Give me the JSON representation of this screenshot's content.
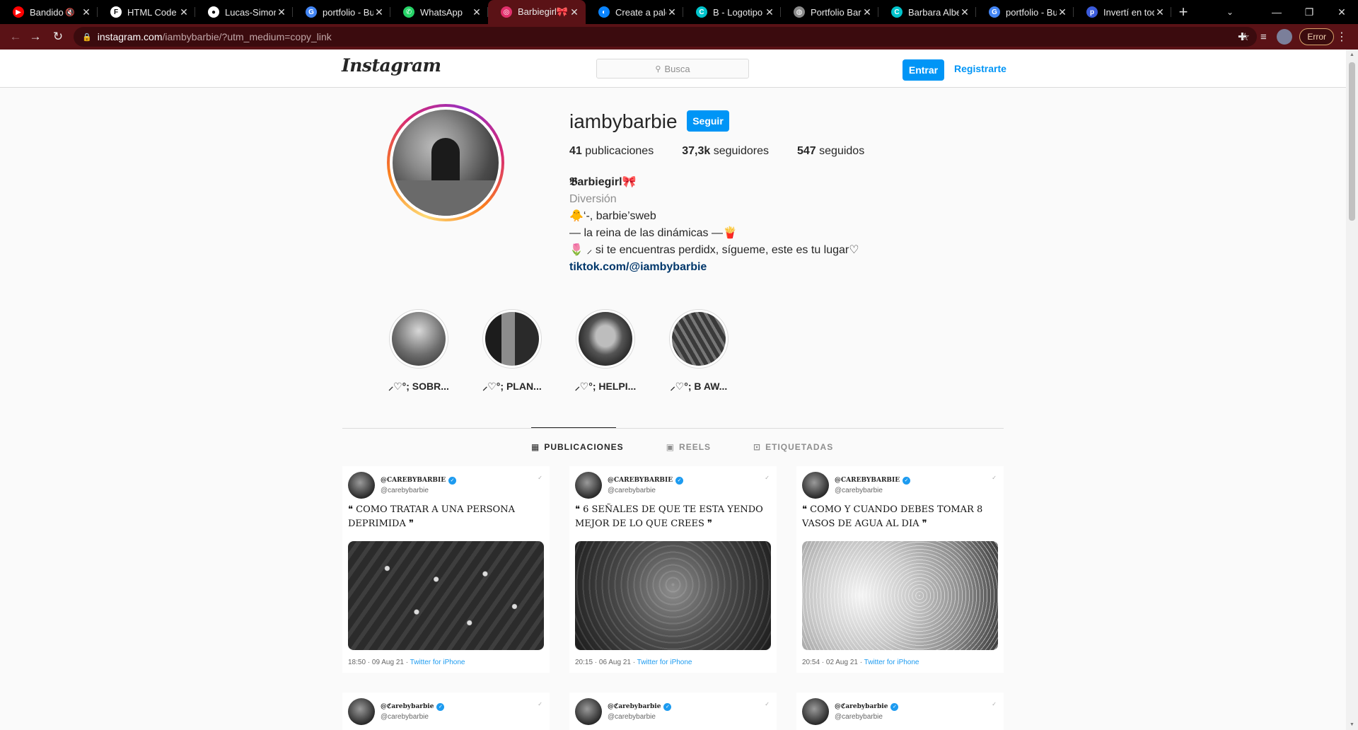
{
  "browser": {
    "tabs": [
      {
        "title": "Bandido",
        "favicon": "youtube-icon",
        "color": "#ff0000",
        "muted": true
      },
      {
        "title": "HTML Code E",
        "favicon": "html-code-icon",
        "color": "#ffffff"
      },
      {
        "title": "Lucas-Simon",
        "favicon": "github-icon",
        "color": "#ffffff"
      },
      {
        "title": "portfolio - Bu",
        "favicon": "google-icon",
        "color": "#4285f4"
      },
      {
        "title": "WhatsApp",
        "favicon": "whatsapp-icon",
        "color": "#25d366"
      },
      {
        "title": "Barbiegirl🎀 (@",
        "favicon": "instagram-icon",
        "color": "#e1306c",
        "active": true
      },
      {
        "title": "Create a pale",
        "favicon": "coolors-icon",
        "color": "#0a84ff"
      },
      {
        "title": "B - Logotipo",
        "favicon": "canva-icon",
        "color": "#00c4cc"
      },
      {
        "title": "Portfolio Barb",
        "favicon": "globe-icon",
        "color": "#8a8a8a"
      },
      {
        "title": "Barbara Alber",
        "favicon": "canva-icon",
        "color": "#00c4cc"
      },
      {
        "title": "portfolio - Bu",
        "favicon": "google-icon",
        "color": "#4285f4"
      },
      {
        "title": "Invertí en tod",
        "favicon": "ppi-icon",
        "color": "#3b5bdb"
      }
    ],
    "url_host": "instagram.com",
    "url_path": "/iambybarbie/?utm_medium=copy_link",
    "error_label": "Error",
    "accent": "#5a1216"
  },
  "ig": {
    "logo": "Instagram",
    "search_placeholder": "Busca",
    "login_label": "Entrar",
    "signup_label": "Registrarte",
    "username": "iambybarbie",
    "follow_label": "Seguir",
    "stats": {
      "posts_count": "41",
      "posts_label": "publicaciones",
      "followers_count": "37,3k",
      "followers_label": "seguidores",
      "following_count": "547",
      "following_label": "seguidos"
    },
    "bio": {
      "name": "𝕭arbiegirl🎀",
      "category": "Diversión",
      "line1": "🐥‘-, barbie’sweb",
      "line2": "— la reina de las dinámicas —🍟",
      "line3": "🌷 ⸝ si te encuentras perdidx, sígueme, este es tu lugar♡",
      "link": "tiktok.com/@iambybarbie"
    },
    "highlights": [
      {
        "label": "⸝♡°; SOBR..."
      },
      {
        "label": "⸝♡°; PLAN..."
      },
      {
        "label": "⸝♡°; HELPI..."
      },
      {
        "label": "⸝♡°; B AW..."
      }
    ],
    "tabs": [
      {
        "label": "PUBLICACIONES",
        "icon": "grid-icon",
        "active": true
      },
      {
        "label": "REELS",
        "icon": "reels-icon"
      },
      {
        "label": "ETIQUETADAS",
        "icon": "tagged-icon"
      }
    ],
    "posts": [
      {
        "handle": "@CAREBYBARBIE",
        "sub": "@carebybarbie",
        "quote": "❝ COMO TRATAR A UNA PERSONA DEPRIMIDA ❞",
        "time": "18:50 · 09 Aug 21 · ",
        "source": "Twitter for iPhone"
      },
      {
        "handle": "@CAREBYBARBIE",
        "sub": "@carebybarbie",
        "quote": "❝ 6 SEÑALES DE QUE TE ESTA YENDO MEJOR DE LO QUE CREES ❞",
        "time": "20:15 · 06 Aug 21 · ",
        "source": "Twitter for iPhone"
      },
      {
        "handle": "@CAREBYBARBIE",
        "sub": "@carebybarbie",
        "quote": "❝ COMO Y CUANDO DEBES TOMAR 8 VASOS DE AGUA AL DIA ❞",
        "time": "20:54 · 02 Aug 21 · ",
        "source": "Twitter for iPhone"
      },
      {
        "handle": "@ℭarebybarbie",
        "sub": "@carebybarbie"
      },
      {
        "handle": "@ℭarebybarbie",
        "sub": "@carebybarbie"
      },
      {
        "handle": "@ℭarebybarbie",
        "sub": "@carebybarbie"
      }
    ]
  }
}
